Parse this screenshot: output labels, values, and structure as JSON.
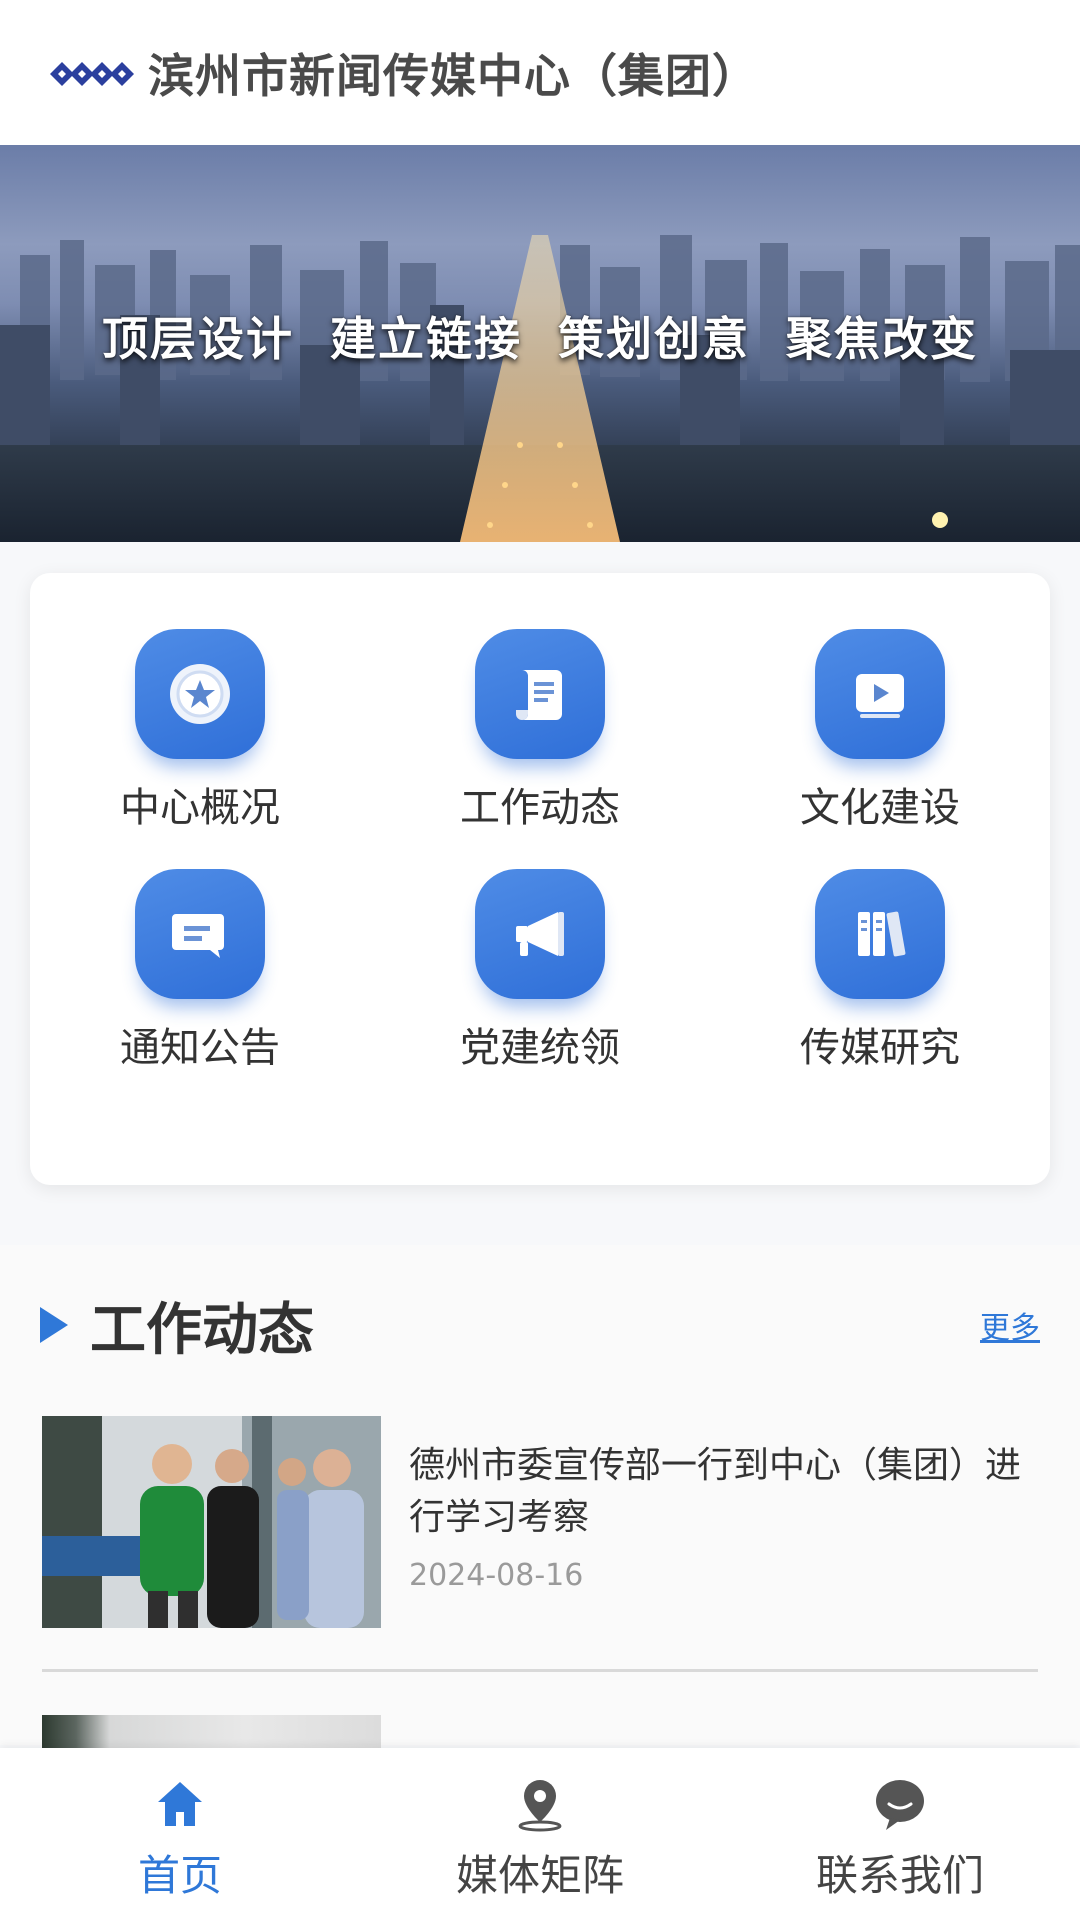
{
  "header": {
    "brand": "滨州市新闻传媒中心（集团）",
    "logo_icon": "wave-logo-icon"
  },
  "banner": {
    "slogans": [
      "顶层设计",
      "建立链接",
      "策划创意",
      "聚焦改变"
    ]
  },
  "menu": {
    "items": [
      {
        "label": "中心概况",
        "icon": "star-badge-icon"
      },
      {
        "label": "工作动态",
        "icon": "scroll-document-icon"
      },
      {
        "label": "文化建设",
        "icon": "play-video-icon"
      },
      {
        "label": "通知公告",
        "icon": "message-icon"
      },
      {
        "label": "党建统领",
        "icon": "megaphone-icon"
      },
      {
        "label": "传媒研究",
        "icon": "books-icon"
      }
    ]
  },
  "section": {
    "title": "工作动态",
    "more": "更多",
    "news": [
      {
        "title": "德州市委宣传部一行到中心（集团）进行学习考察",
        "date": "2024-08-16"
      }
    ]
  },
  "tabbar": {
    "items": [
      {
        "label": "首页",
        "icon": "home-icon",
        "active": true
      },
      {
        "label": "媒体矩阵",
        "icon": "location-pin-icon",
        "active": false
      },
      {
        "label": "联系我们",
        "icon": "chat-bubble-icon",
        "active": false
      }
    ]
  },
  "colors": {
    "accent": "#2f78d8",
    "icon_bg": "#3b7de0",
    "text": "#333333",
    "date": "#9a9a9a"
  }
}
